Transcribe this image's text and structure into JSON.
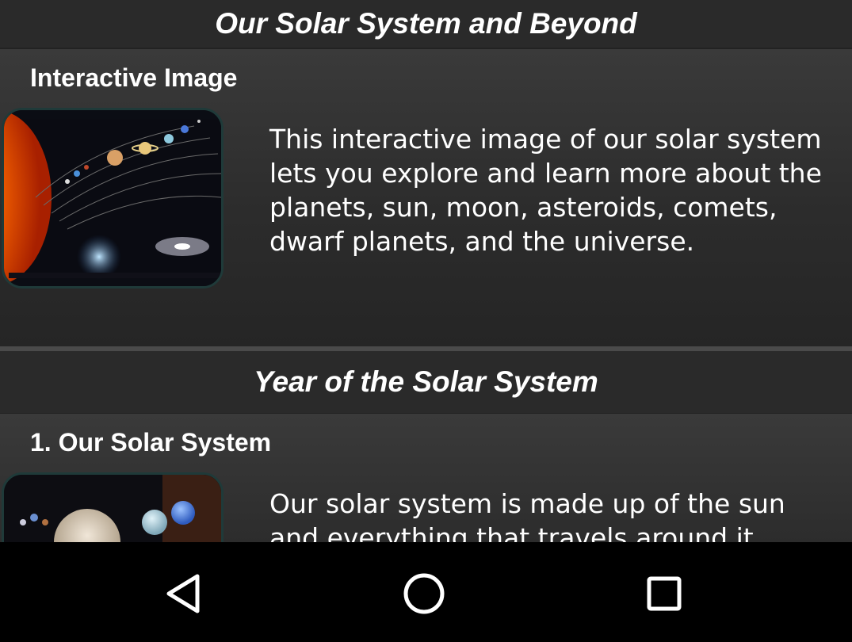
{
  "sections": [
    {
      "header": "Our Solar System and Beyond",
      "item": {
        "title": "Interactive Image",
        "description": "This interactive image of our solar system lets you explore and learn more about the planets, sun, moon, asteroids, comets, dwarf planets, and the universe.",
        "thumbnail_icon": "solar-system-image"
      }
    },
    {
      "header": "Year of the Solar System",
      "item": {
        "title": "1. Our Solar System",
        "description": "Our solar system is made up of the sun and everything that travels around it.",
        "thumbnail_icon": "planets-image"
      }
    }
  ],
  "navbar": {
    "back_icon": "back-triangle-icon",
    "home_icon": "home-circle-icon",
    "recents_icon": "recents-square-icon"
  },
  "colors": {
    "background": "#222222",
    "header_bg": "#2a2a2a",
    "thumb_border": "#1f3a39",
    "navbar_bg": "#000000",
    "text": "#ffffff"
  }
}
